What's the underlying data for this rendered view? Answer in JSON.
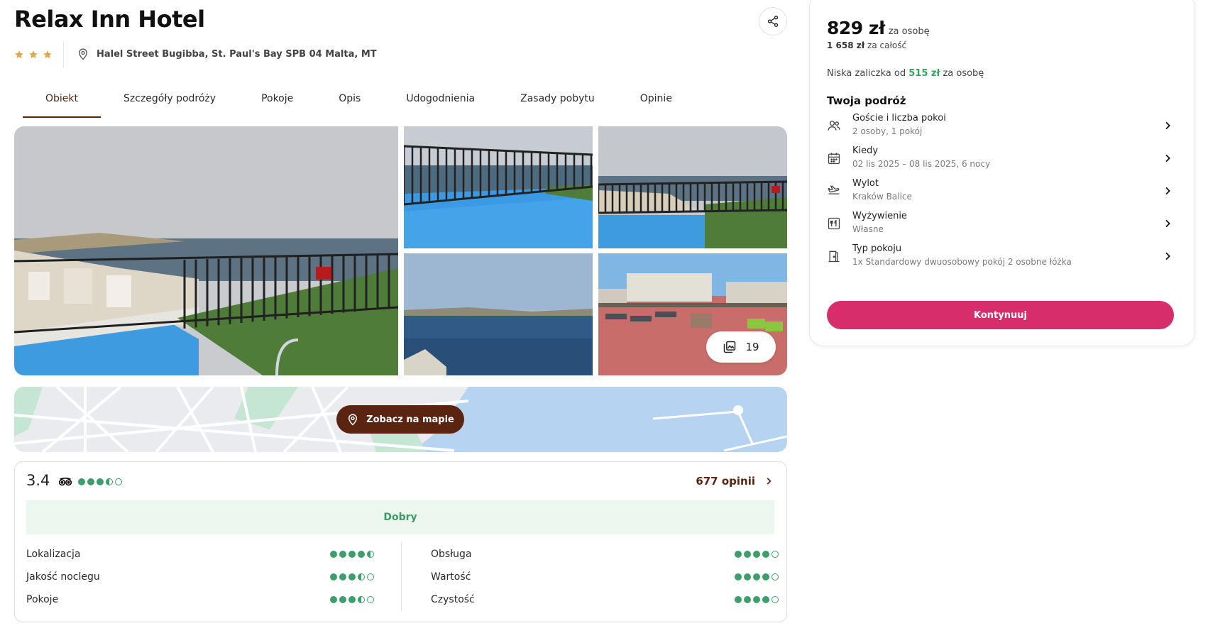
{
  "hotel": {
    "name": "Relax Inn Hotel",
    "stars": 3,
    "address": "Halel Street Bugibba, St. Paul's Bay SPB 04 Malta, MT"
  },
  "tabs": [
    {
      "label": "Obiekt",
      "active": true
    },
    {
      "label": "Szczegóły podróży",
      "active": false
    },
    {
      "label": "Pokoje",
      "active": false
    },
    {
      "label": "Opis",
      "active": false
    },
    {
      "label": "Udogodnienia",
      "active": false
    },
    {
      "label": "Zasady pobytu",
      "active": false
    },
    {
      "label": "Opinie",
      "active": false
    }
  ],
  "gallery": {
    "photo_count": "19"
  },
  "map": {
    "button_label": "Zobacz na mapie"
  },
  "reviews": {
    "score": "3.4",
    "score_bubbles": 3.5,
    "opinions_label": "677 opinii",
    "verdict": "Dobry",
    "categories_left": [
      {
        "label": "Lokalizacja",
        "bubbles": 4.5
      },
      {
        "label": "Jakość noclegu",
        "bubbles": 3.5
      },
      {
        "label": "Pokoje",
        "bubbles": 3.5
      }
    ],
    "categories_right": [
      {
        "label": "Obsługa",
        "bubbles": 4
      },
      {
        "label": "Wartość",
        "bubbles": 4
      },
      {
        "label": "Czystość",
        "bubbles": 4
      }
    ]
  },
  "booking": {
    "price": "829 zł",
    "price_unit": "za osobę",
    "total_amount": "1 658 zł",
    "total_label": "za całość",
    "deposit_prefix": "Niska zaliczka od",
    "deposit_amount": "515 zł",
    "deposit_suffix": "za osobę",
    "trip_title": "Twoja podróż",
    "rows": [
      {
        "icon": "guests-icon",
        "label": "Goście i liczba pokoi",
        "value": "2 osoby, 1 pokój"
      },
      {
        "icon": "calendar-icon",
        "label": "Kiedy",
        "value": "02 lis 2025 – 08 lis 2025, 6 nocy"
      },
      {
        "icon": "plane-icon",
        "label": "Wylot",
        "value": "Kraków Balice"
      },
      {
        "icon": "meal-icon",
        "label": "Wyżywienie",
        "value": "Własne"
      },
      {
        "icon": "door-icon",
        "label": "Typ pokoju",
        "value": "1x Standardowy dwuosobowy pokój 2 osobne łóżka"
      }
    ],
    "continue_label": "Kontynuuj"
  },
  "colors": {
    "brand_brown": "#5b2410",
    "cta_pink": "#d72e6b",
    "rating_green": "#3c9e6c",
    "star_gold": "#e0a84b"
  }
}
